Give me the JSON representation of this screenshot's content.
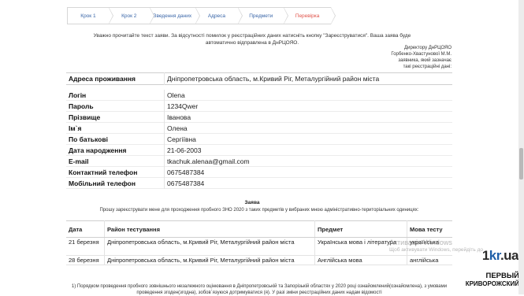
{
  "steps": [
    {
      "label": "Крок 1",
      "state": "done"
    },
    {
      "label": "Крок 2",
      "state": "done"
    },
    {
      "label": "Введення даних",
      "state": "done"
    },
    {
      "label": "Адреса",
      "state": "done"
    },
    {
      "label": "Предмети",
      "state": "done"
    },
    {
      "label": "Перевірка",
      "state": "active"
    }
  ],
  "notice": "Уважно прочитайте текст заяви. За відсутності помилок у реєстраційних даних натисніть кнопку \"Зареєструватися\". Ваша заява буде автоматично відправлена в ДнРЦОЯО.",
  "addressee": {
    "line1": "Директору ДнРЦОЯО",
    "line2": "Горбенко-Хвастунової М.М.",
    "line3": "заявника, який зазначає",
    "line4": "такі реєстраційні дані:"
  },
  "address": {
    "label": "Адреса проживання",
    "value": "Дніпропетровська область, м.Кривий Ріг, Металургійний район міста"
  },
  "personal": [
    {
      "label": "Логін",
      "value": "Olena"
    },
    {
      "label": "Пароль",
      "value": "1234Qwer"
    },
    {
      "label": "Прізвище",
      "value": "Іванова"
    },
    {
      "label": "Ім`я",
      "value": "Олена"
    },
    {
      "label": "По батькові",
      "value": "Сергіївна"
    },
    {
      "label": "Дата народження",
      "value": "21-06-2003"
    },
    {
      "label": "E-mail",
      "value": "tkachuk.alenaa@gmail.com"
    },
    {
      "label": "Контактний телефон",
      "value": "0675487384"
    },
    {
      "label": "Мобільний телефон",
      "value": "0675487384"
    }
  ],
  "zayava": {
    "title": "Заява",
    "text": "Прошу зареєструвати мене для проходження пробного ЗНО 2020 з таких предметів у вибраних мною адміністративно-територіальних одиницях:"
  },
  "exams": {
    "headers": [
      "Дата",
      "Район тестування",
      "Предмет",
      "Мова тесту"
    ],
    "rows": [
      {
        "date": "21 березня",
        "district": "Дніпропетровська область, м.Кривий Ріг, Металургійний район міста",
        "subject": "Українська мова і література",
        "lang": "українська"
      },
      {
        "date": "28 березня",
        "district": "Дніпропетровська область, м.Кривий Ріг, Металургійний район міста",
        "subject": "Англійська мова",
        "lang": "англійська"
      }
    ]
  },
  "footnote": "1) Порядком проведення пробного зовнішнього незалежного оцінювання в Дніпропетровській та Запорізькій областях у 2020 році ознайомлений(ознайомлена), з умовами проведення згоден(згодна), зобов`язуюся дотримуватися (я). У разі зміни реєстраційних даних надам відомості",
  "watermark": {
    "line1": "Активація Windows",
    "line2": "Щоб активувати Windows, перейдіть до"
  },
  "logo": {
    "domain_a": "1",
    "domain_b": "kr",
    "domain_c": ".ua",
    "line1": "ПЕРВЫЙ",
    "line2": "КРИВОРОЖСКИЙ"
  },
  "colors": {
    "step_text": "#3a66a8",
    "step_active": "#e0534a",
    "brand_blue": "#1f5fa8"
  }
}
